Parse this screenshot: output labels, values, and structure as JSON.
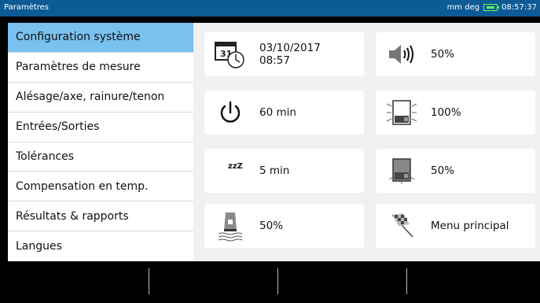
{
  "header": {
    "title": "Paramètres",
    "units": "mm deg",
    "time": "08:57:37",
    "battery_icon": "battery-charging-icon",
    "battery_color": "#5cff57",
    "bar_color": "#0c5b96"
  },
  "sidebar": {
    "accent": "#79c1ee",
    "items": [
      {
        "label": "Configuration système"
      },
      {
        "label": "Paramètres de mesure"
      },
      {
        "label": "Alésage/axe, rainure/tenon"
      },
      {
        "label": "Entrées/Sorties"
      },
      {
        "label": "Tolérances"
      },
      {
        "label": "Compensation en temp."
      },
      {
        "label": "Résultats & rapports"
      },
      {
        "label": "Langues"
      }
    ]
  },
  "tiles": {
    "date": {
      "date": "03/10/2017",
      "time": "08:57",
      "icon": "calendar-clock-icon",
      "calendar_day": "31"
    },
    "volume": {
      "value": "50%",
      "icon": "speaker-icon"
    },
    "sleep_timer": {
      "value": "60 min",
      "icon": "power-icon"
    },
    "brightness_full": {
      "value": "100%",
      "icon": "display-brightness-high-icon"
    },
    "dim_timer": {
      "value": "5 min",
      "icon": "moon-sleep-icon",
      "icon_text": "zzZ"
    },
    "brightness_dim": {
      "value": "50%",
      "icon": "display-brightness-low-icon"
    },
    "laser": {
      "value": "50%",
      "icon": "laser-intensity-icon"
    },
    "main_menu": {
      "value": "Menu principal",
      "icon": "checkered-flag-icon"
    }
  }
}
